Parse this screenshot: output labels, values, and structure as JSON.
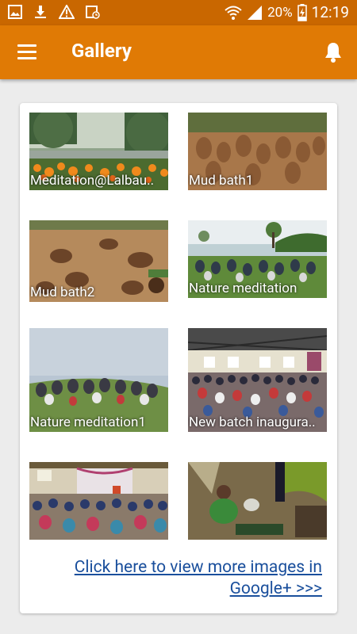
{
  "status_bar": {
    "battery": "20%",
    "time": "12:19"
  },
  "app_bar": {
    "title": "Gallery"
  },
  "gallery": {
    "items": [
      {
        "caption": "Meditation@Lalbau.."
      },
      {
        "caption": "Mud bath1"
      },
      {
        "caption": "Mud bath2"
      },
      {
        "caption": "Nature meditation"
      },
      {
        "caption": "Nature meditation1"
      },
      {
        "caption": "New batch inaugura.."
      },
      {
        "caption": ""
      },
      {
        "caption": ""
      }
    ],
    "more_link": "Click here to view more images in Google+ >>>"
  },
  "colors": {
    "status_bar": "#c96700",
    "app_bar": "#e07a05",
    "link": "#1a4f9c"
  }
}
